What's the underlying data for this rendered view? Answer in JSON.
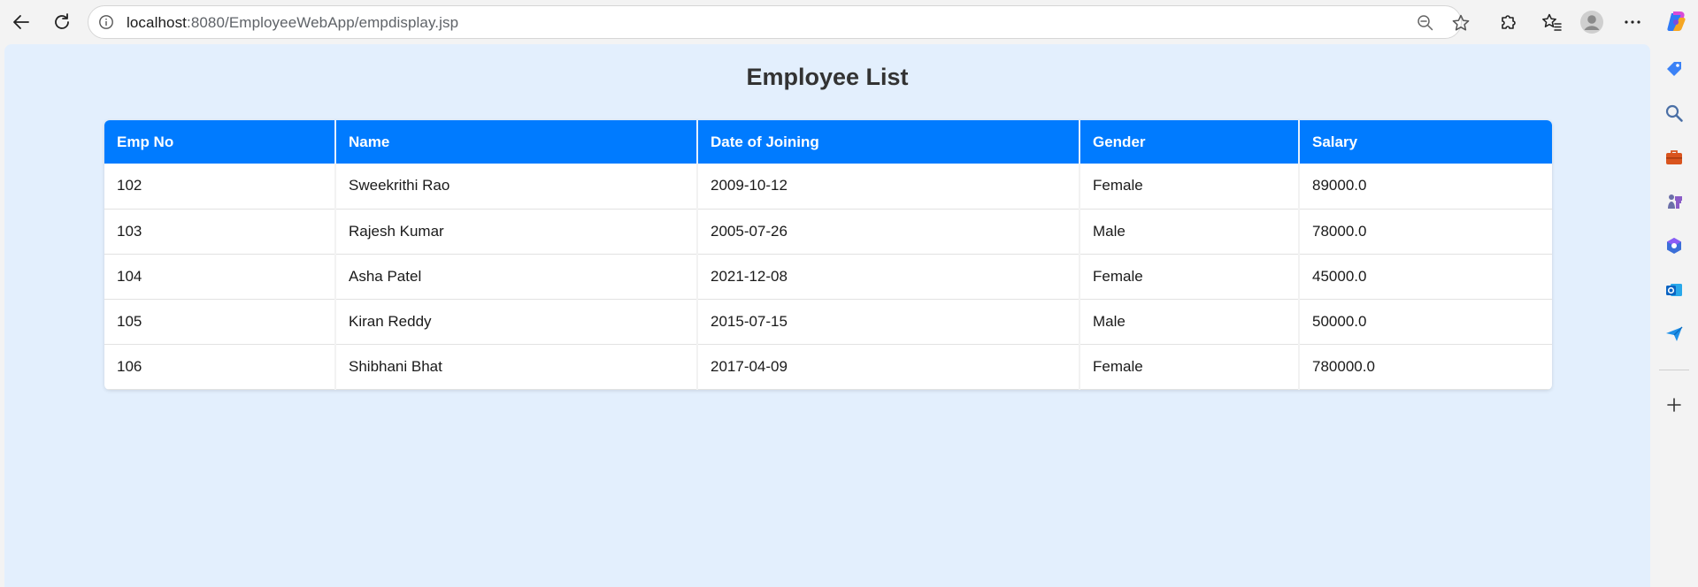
{
  "browser": {
    "url_host": "localhost",
    "url_path": ":8080/EmployeeWebApp/empdisplay.jsp",
    "icons": {
      "back": "back-arrow-icon",
      "refresh": "refresh-icon",
      "info": "info-icon",
      "zoom": "zoom-out-icon",
      "favorite": "star-icon",
      "extensions": "puzzle-icon",
      "favorites_list": "favorites-icon",
      "profile": "profile-avatar-icon",
      "menu": "more-horizontal-icon",
      "copilot": "copilot-icon"
    },
    "sidebar_icons": [
      "tag-icon",
      "search-icon",
      "briefcase-icon",
      "chess-icon",
      "m365-icon",
      "outlook-icon",
      "send-icon",
      "plus-icon"
    ]
  },
  "page": {
    "title": "Employee List",
    "table": {
      "headers": [
        "Emp No",
        "Name",
        "Date of Joining",
        "Gender",
        "Salary"
      ],
      "rows": [
        [
          "102",
          "Sweekrithi Rao",
          "2009-10-12",
          "Female",
          "89000.0"
        ],
        [
          "103",
          "Rajesh Kumar",
          "2005-07-26",
          "Male",
          "78000.0"
        ],
        [
          "104",
          "Asha Patel",
          "2021-12-08",
          "Female",
          "45000.0"
        ],
        [
          "105",
          "Kiran Reddy",
          "2015-07-15",
          "Male",
          "50000.0"
        ],
        [
          "106",
          "Shibhani Bhat",
          "2017-04-09",
          "Female",
          "780000.0"
        ]
      ]
    }
  },
  "colors": {
    "page_background": "#e3effd",
    "header_blue": "#007bff",
    "title_text": "#333333"
  }
}
